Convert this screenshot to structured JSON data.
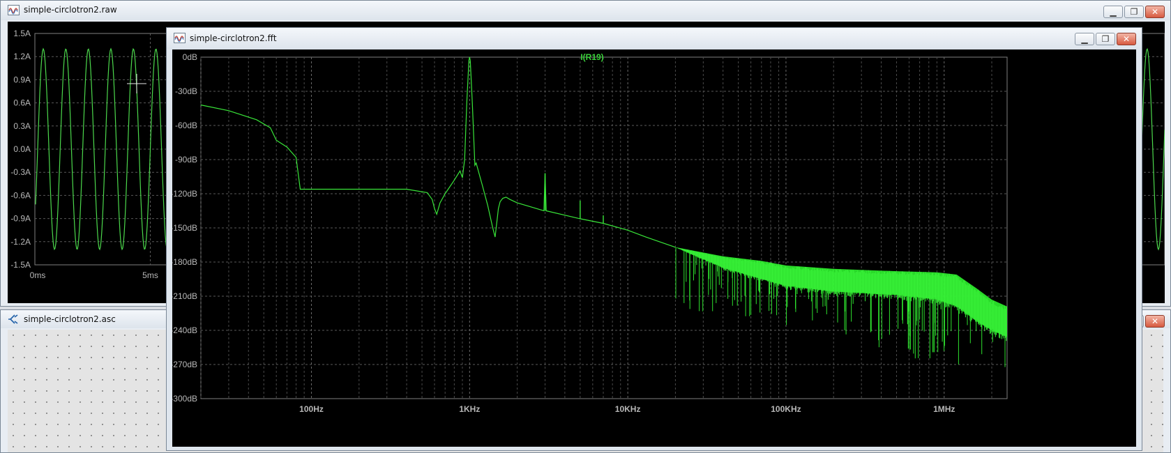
{
  "windows": {
    "raw": {
      "title": "simple-circlotron2.raw",
      "trace_label_partial": "I(R19)",
      "y_ticks": [
        "1.5A",
        "1.2A",
        "0.9A",
        "0.6A",
        "0.3A",
        "0.0A",
        "-0.3A",
        "-0.6A",
        "-0.9A",
        "-1.2A",
        "-1.5A"
      ],
      "x_ticks": [
        "0ms",
        "5ms"
      ]
    },
    "fft": {
      "title": "simple-circlotron2.fft",
      "trace_label": "I(R19)"
    },
    "asc": {
      "title": "simple-circlotron2.asc"
    }
  },
  "chart_data": [
    {
      "type": "line",
      "xlabel": "",
      "ylabel": "",
      "x_unit": "ms",
      "ylim": [
        -1.5,
        1.5
      ],
      "x_ticks": [
        "0ms",
        "5ms"
      ],
      "y_ticks": [
        "1.5A",
        "1.2A",
        "0.9A",
        "0.6A",
        "0.3A",
        "0.0A",
        "-0.3A",
        "-0.6A",
        "-0.9A",
        "-1.2A",
        "-1.5A"
      ],
      "grid": true,
      "series": [
        {
          "name": "I(R19)",
          "frequency_hz": 1000,
          "amplitude_a": 1.3,
          "color": "#4cd94c"
        }
      ]
    },
    {
      "type": "line",
      "title": "I(R19)",
      "x_scale": "log",
      "xlim_hz": [
        20,
        2500000
      ],
      "ylim_db": [
        -300,
        0
      ],
      "x_ticks": [
        "100Hz",
        "1KHz",
        "10KHz",
        "100KHz",
        "1MHz"
      ],
      "y_ticks": [
        "0dB",
        "-30dB",
        "-60dB",
        "-90dB",
        "-120dB",
        "-150dB",
        "-180dB",
        "-210dB",
        "-240dB",
        "-270dB",
        "-300dB"
      ],
      "grid": true,
      "series": [
        {
          "name": "I(R19)",
          "color": "#39e639",
          "x": [
            20,
            30,
            45,
            55,
            60,
            70,
            80,
            85,
            100,
            200,
            400,
            540,
            580,
            600,
            620,
            650,
            700,
            800,
            870,
            900,
            930,
            960,
            990,
            1000,
            1010,
            1040,
            1080,
            1100,
            1120,
            1200,
            1300,
            1400,
            1450,
            1500,
            1520,
            1560,
            1620,
            1700,
            1800,
            2000,
            2500,
            2950,
            3000,
            3050,
            5000,
            7000,
            10000,
            13000,
            20000
          ],
          "y": [
            -42,
            -47,
            -55,
            -62,
            -73,
            -79,
            -88,
            -116,
            -116,
            -116,
            -116,
            -119,
            -125,
            -133,
            -138,
            -128,
            -120,
            -108,
            -100,
            -106,
            -90,
            -40,
            -3,
            0,
            -3,
            -40,
            -95,
            -93,
            -97,
            -112,
            -130,
            -150,
            -158,
            -140,
            -133,
            -127,
            -124,
            -123,
            -125,
            -128,
            -132,
            -135,
            -102,
            -135,
            -142,
            -146,
            -152,
            -158,
            -167
          ]
        }
      ],
      "harmonic_spurs": [
        {
          "x": 3000,
          "y": -102
        },
        {
          "x": 5000,
          "y": -126
        },
        {
          "x": 7000,
          "y": -139
        }
      ],
      "noise_floor_envelope": {
        "x": [
          20000,
          40000,
          70000,
          100000,
          200000,
          500000,
          900000,
          1200000,
          1600000,
          2000000,
          2500000
        ],
        "upper": [
          -167,
          -175,
          -179,
          -183,
          -186,
          -188,
          -189,
          -191,
          -203,
          -213,
          -219
        ],
        "lower": [
          -167,
          -185,
          -195,
          -201,
          -206,
          -209,
          -213,
          -219,
          -232,
          -240,
          -246
        ],
        "min_spikes": [
          -225,
          -230,
          -240,
          -255,
          -265,
          -275
        ]
      }
    }
  ]
}
